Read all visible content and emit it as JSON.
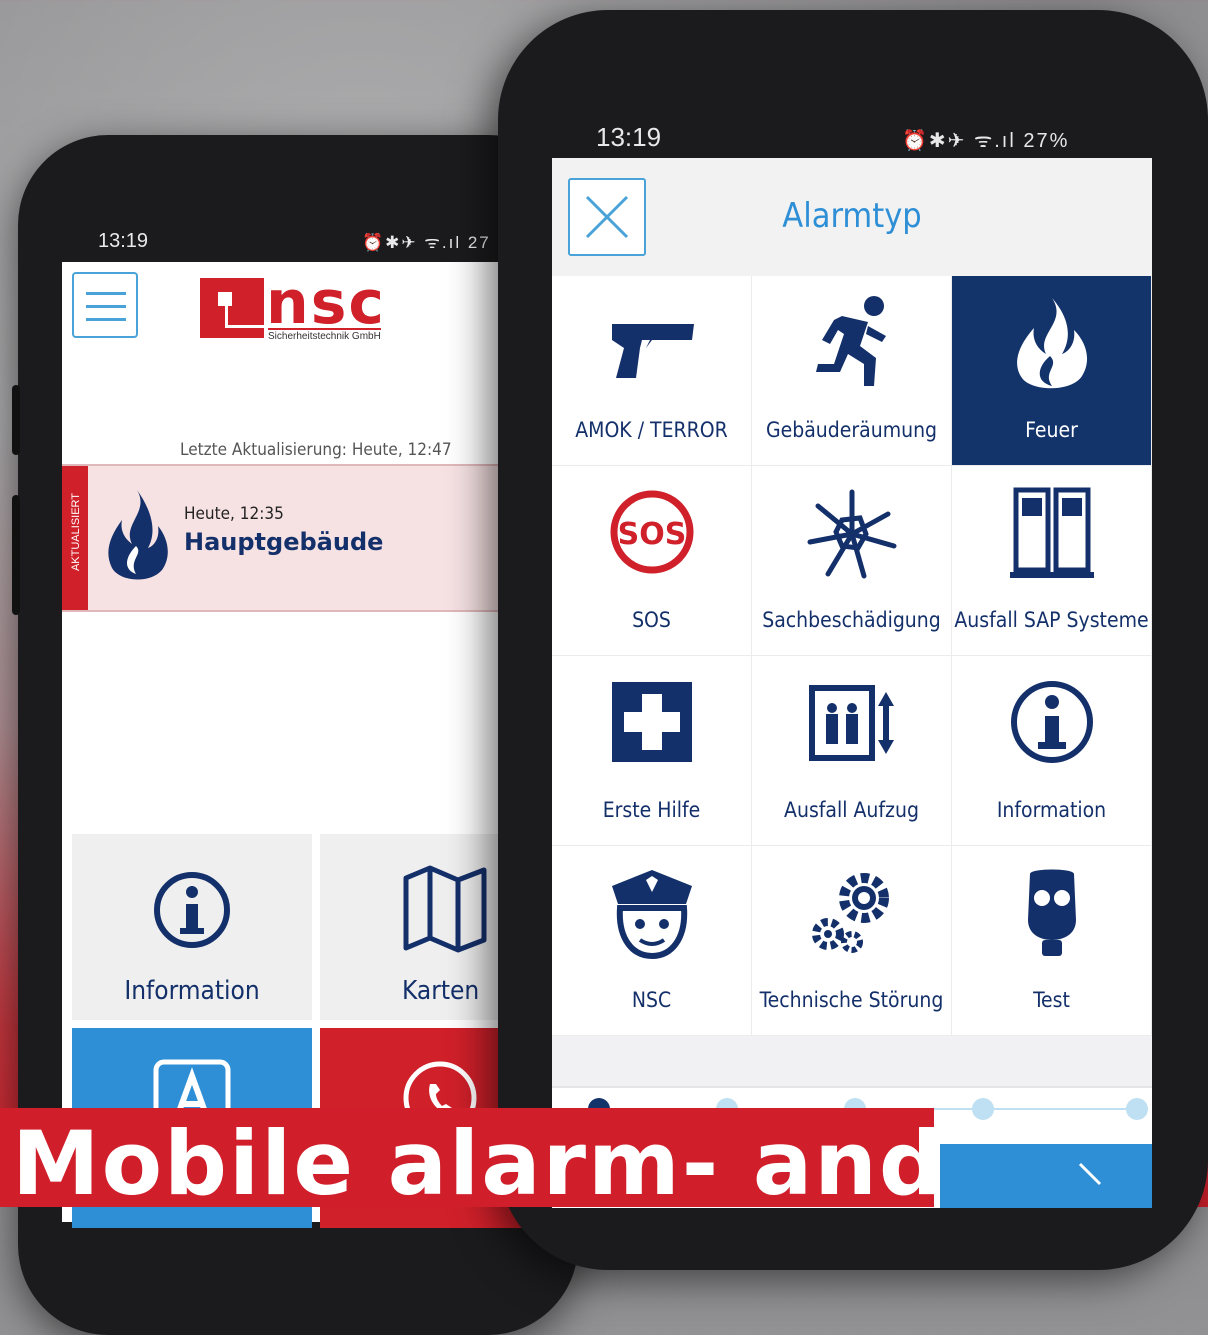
{
  "left_phone": {
    "status_time": "13:19",
    "status_icons": "⏰✱✈ ᯤ.ıl 27",
    "logo": {
      "text": "nsc",
      "subtitle": "Sicherheitstechnik GmbH"
    },
    "last_update": "Letzte Aktualisierung: Heute, 12:47",
    "alert": {
      "tag": "AKTUALISIERT",
      "time": "Heute, 12:35",
      "title": "Hauptgebäude",
      "icon": "fire-icon"
    },
    "tiles": [
      {
        "label": "Information",
        "icon": "info-icon"
      },
      {
        "label": "Karten",
        "icon": "map-icon"
      }
    ]
  },
  "right_phone": {
    "status_time": "13:19",
    "status_battery": "⏰✱✈ ᯤ.ıl 27%",
    "title": "Alarmtyp",
    "alarm_types": [
      {
        "label": "AMOK / TERROR",
        "icon": "gun-icon",
        "selected": false
      },
      {
        "label": "Gebäuderäumung",
        "icon": "running-person-icon",
        "selected": false
      },
      {
        "label": "Feuer",
        "icon": "fire-icon",
        "selected": true
      },
      {
        "label": "SOS",
        "icon": "sos-icon",
        "selected": false
      },
      {
        "label": "Sachbeschädigung",
        "icon": "broken-glass-icon",
        "selected": false
      },
      {
        "label": "Ausfall SAP Systeme",
        "icon": "server-icon",
        "selected": false
      },
      {
        "label": "Erste Hilfe",
        "icon": "first-aid-icon",
        "selected": false
      },
      {
        "label": "Ausfall Aufzug",
        "icon": "elevator-icon",
        "selected": false
      },
      {
        "label": "Information",
        "icon": "info-icon",
        "selected": false
      },
      {
        "label": "NSC",
        "icon": "police-officer-icon",
        "selected": false
      },
      {
        "label": "Technische Störung",
        "icon": "gears-icon",
        "selected": false
      },
      {
        "label": "Test",
        "icon": "gas-mask-icon",
        "selected": false
      }
    ],
    "progress": {
      "steps": 5,
      "current": 1
    }
  },
  "banner": {
    "text": "Mobile alarm- and"
  },
  "colors": {
    "navy": "#13336b",
    "blue": "#2f8fd6",
    "red": "#d0202a"
  }
}
